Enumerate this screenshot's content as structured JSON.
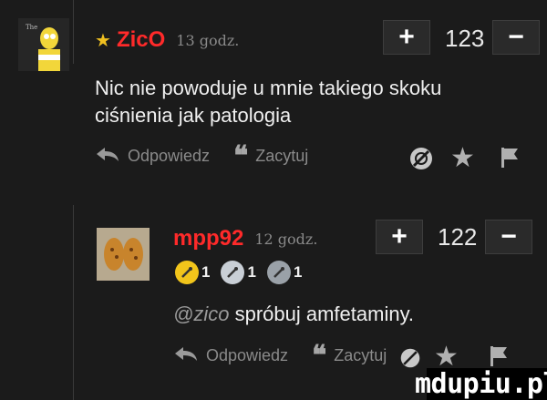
{
  "comments": [
    {
      "username": "ZicO",
      "time": "13 godz.",
      "score": "123",
      "plus": "+",
      "minus": "−",
      "text": "Nic nie powoduje u mnie takiego skoku ciśnienia jak patologia",
      "reply_label": "Odpowiedz",
      "quote_label": "Zacytuj"
    },
    {
      "username": "mpp92",
      "time": "12 godz.",
      "score": "122",
      "plus": "+",
      "minus": "−",
      "mention": "@zico",
      "text": "spróbuj amfetaminy.",
      "reply_label": "Odpowiedz",
      "quote_label": "Zacytuj",
      "badges": [
        {
          "icon": "yellow-badge-icon",
          "count": "1",
          "color": "#f2c51b"
        },
        {
          "icon": "silver-badge-icon",
          "count": "1",
          "color": "#c9cfd6"
        },
        {
          "icon": "gray-badge-icon",
          "count": "1",
          "color": "#9aa1a8"
        }
      ]
    }
  ],
  "watermark": "mdupiu.pl",
  "colors": {
    "username": "#ff2a2a",
    "star": "#f0c020",
    "background": "#1b1b1b"
  }
}
